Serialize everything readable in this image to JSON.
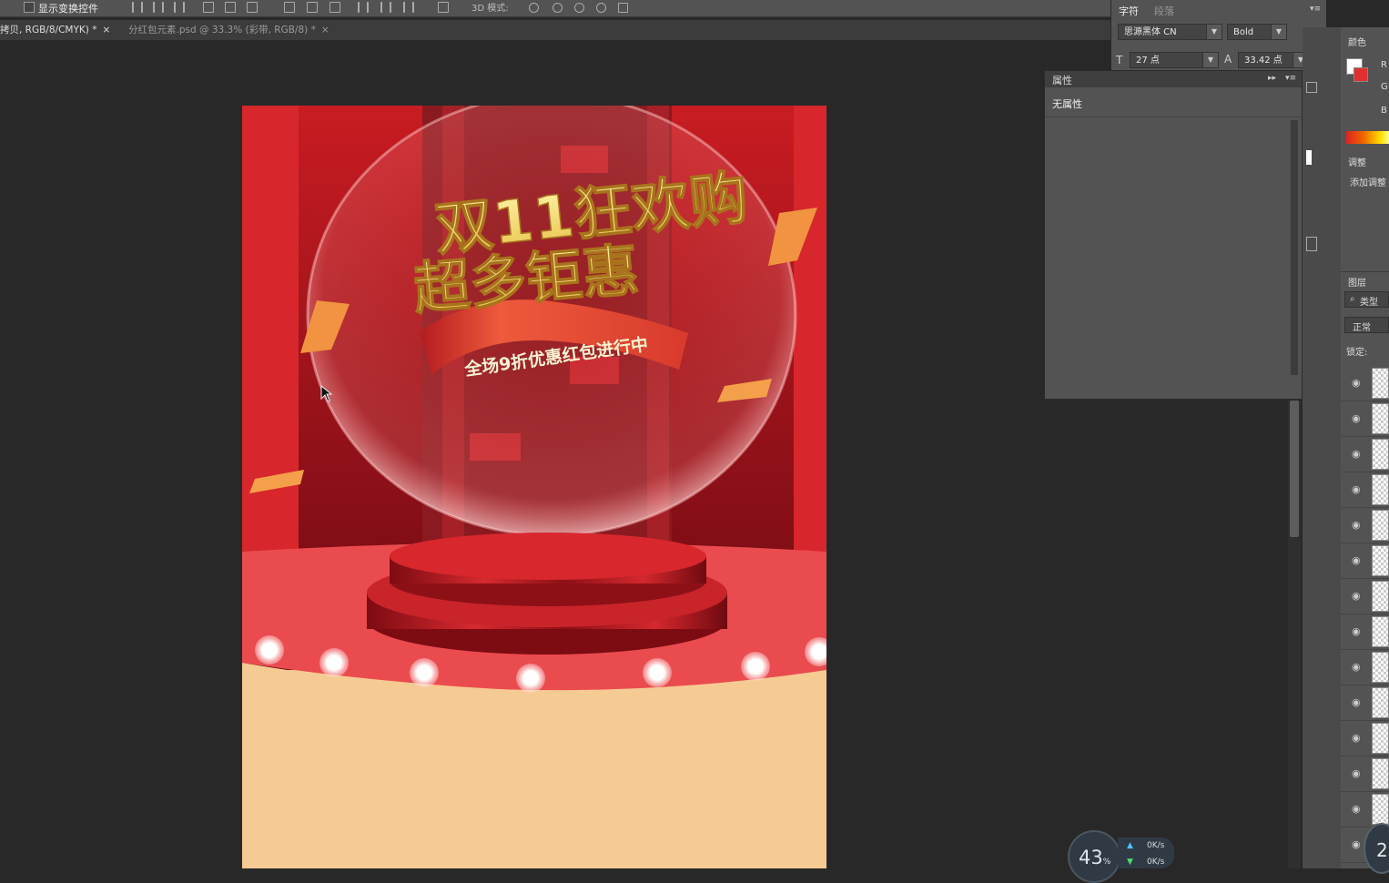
{
  "options_bar": {
    "show_transform_controls": "显示变换控件",
    "mode_3d": "3D 模式:"
  },
  "tabs": [
    {
      "label": "拷贝, RGB/8/CMYK) *",
      "close": "×"
    },
    {
      "label": "分红包元素.psd @ 33.3% (彩带, RGB/8) *",
      "close": "×"
    }
  ],
  "canvas": {
    "headline_line1": "双11狂欢购",
    "headline_line2": "超多钜惠",
    "ribbon_text": "全场9折优惠红包进行中"
  },
  "character_panel": {
    "tab_character": "字符",
    "tab_paragraph": "段落",
    "font_family": "思源黑体 CN",
    "font_style": "Bold",
    "font_size": "27 点",
    "leading": "33.42 点"
  },
  "properties_panel": {
    "title": "属性",
    "content": "无属性"
  },
  "right_panel": {
    "color_tab": "颜色",
    "r_label": "R",
    "g_label": "G",
    "b_label": "B",
    "adjust_tab": "调整",
    "adjust_hint": "添加调整",
    "layers_tab": "图层",
    "search_kind": "类型",
    "blend_mode": "正常",
    "lock_label": "锁定:"
  },
  "monitor": {
    "cpu_value": "43",
    "cpu_unit": "%",
    "up": "0",
    "up_unit": "K/s",
    "down": "0",
    "down_unit": "K/s",
    "badge": "2"
  },
  "colors": {
    "poster_red": "#d7252a",
    "poster_cream": "#f6ca93",
    "headline_gold": "#f2dc6a",
    "ui_dark": "#282828",
    "ui_panel": "#535353"
  }
}
